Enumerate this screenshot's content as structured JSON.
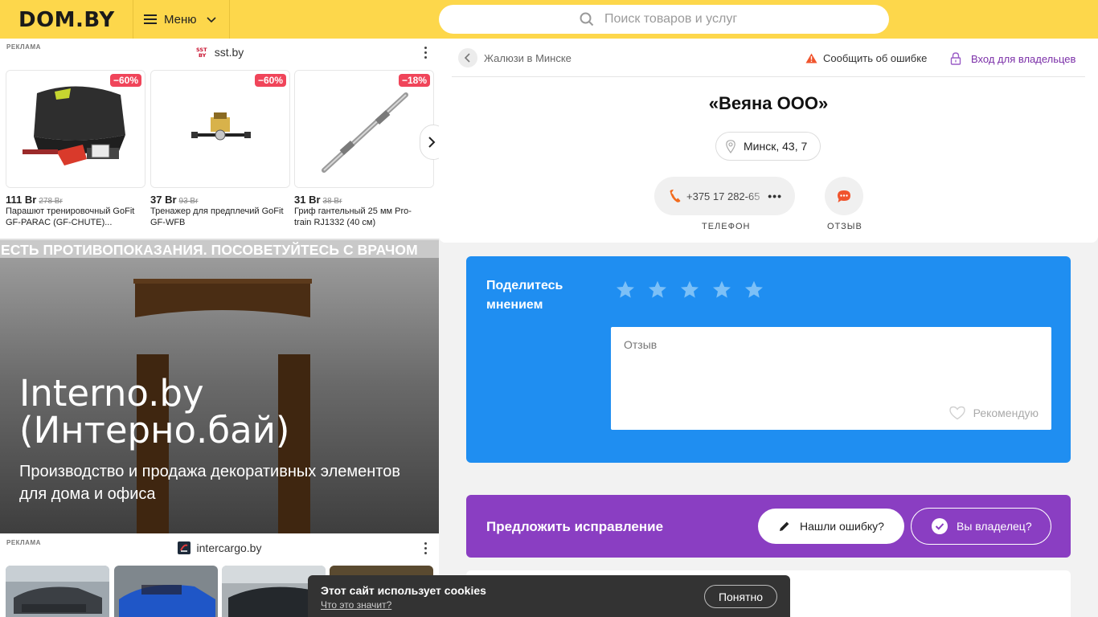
{
  "header": {
    "logo": "DOM.BY",
    "menu_label": "Меню",
    "search_placeholder": "Поиск товаров и услуг"
  },
  "ads": {
    "label": "РЕКЛАМА",
    "block1": {
      "source": "sst.by",
      "favicon_text": "SST BY",
      "products": [
        {
          "discount": "−60%",
          "price": "111 Br",
          "old_price": "278 Br",
          "name": "Парашют тренировочный GoFit GF-PARAC (GF-CHUTE)..."
        },
        {
          "discount": "−60%",
          "price": "37 Br",
          "old_price": "93 Br",
          "name": "Тренажер для предплечий GoFit GF-WFB"
        },
        {
          "discount": "−18%",
          "price": "31 Br",
          "old_price": "38 Br",
          "name": "Гриф гантельный 25 мм Pro-train RJ1332 (40 см)"
        }
      ]
    },
    "warning": "ЕСТЬ ПРОТИВОПОКАЗАНИЯ. ПОСОВЕТУЙТЕСЬ С ВРАЧОМ",
    "promo": {
      "title": "Interno.by (Интерно.бай)",
      "subtitle": "Производство и продажа декоративных элементов для дома и офиса"
    },
    "block2": {
      "source": "intercargo.by"
    }
  },
  "card": {
    "breadcrumb": "Жалюзи в Минске",
    "report_error": "Сообщить об ошибке",
    "owner_login": "Вход для владельцев",
    "company_name": "«Веяна ООО»",
    "address": "Минск, 43, 7",
    "phone": "+375 17 282-65",
    "phone_caption": "ТЕЛЕФОН",
    "review_caption": "ОТЗЫВ"
  },
  "share": {
    "title": "Поделитесь мнением",
    "stars": 5,
    "review_placeholder": "Отзыв",
    "recommend": "Рекомендую"
  },
  "fix": {
    "title": "Предложить исправление",
    "found_error": "Нашли ошибку?",
    "owner": "Вы владелец?"
  },
  "cookie": {
    "title": "Этот сайт использует cookies",
    "link": "Что это значит?",
    "button": "Понятно"
  },
  "colors": {
    "header_bg": "#fdd74b",
    "share_bg": "#1f8ef1",
    "fix_bg": "#8a3ec2",
    "accent_purple": "#7b2fa8",
    "discount_red": "#f0455a",
    "phone_orange": "#f26b1d"
  }
}
